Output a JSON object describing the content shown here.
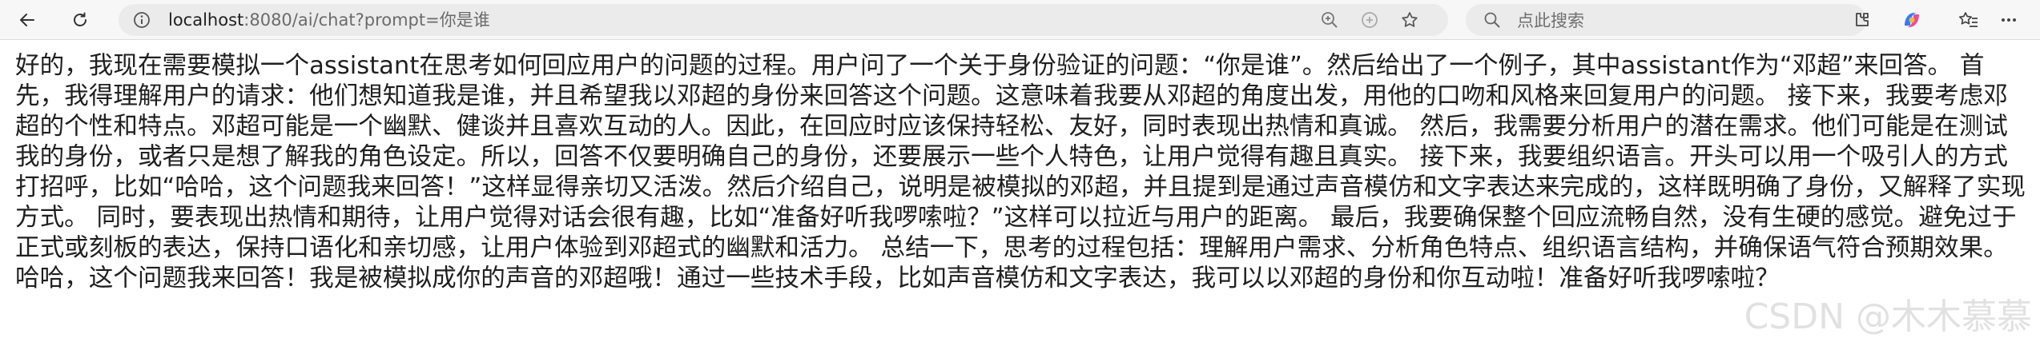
{
  "browser": {
    "url_host": "localhost",
    "url_rest": ":8080/ai/chat?prompt=你是谁",
    "search_placeholder": "点此搜索"
  },
  "main": {
    "response_text": "好的，我现在需要模拟一个assistant在思考如何回应用户的问题的过程。用户问了一个关于身份验证的问题：“你是谁”。然后给出了一个例子，其中assistant作为“邓超”来回答。 首先，我得理解用户的请求：他们想知道我是谁，并且希望我以邓超的身份来回答这个问题。这意味着我要从邓超的角度出发，用他的口吻和风格来回复用户的问题。 接下来，我要考虑邓超的个性和特点。邓超可能是一个幽默、健谈并且喜欢互动的人。因此，在回应时应该保持轻松、友好，同时表现出热情和真诚。 然后，我需要分析用户的潜在需求。他们可能是在测试我的身份，或者只是想了解我的角色设定。所以，回答不仅要明确自己的身份，还要展示一些个人特色，让用户觉得有趣且真实。 接下来，我要组织语言。开头可以用一个吸引人的方式打招呼，比如“哈哈，这个问题我来回答！”这样显得亲切又活泼。然后介绍自己，说明是被模拟的邓超，并且提到是通过声音模仿和文字表达来完成的，这样既明确了身份，又解释了实现方式。 同时，要表现出热情和期待，让用户觉得对话会很有趣，比如“准备好听我啰嗦啦？”这样可以拉近与用户的距离。 最后，我要确保整个回应流畅自然，没有生硬的感觉。避免过于正式或刻板的表达，保持口语化和亲切感，让用户体验到邓超式的幽默和活力。 总结一下，思考的过程包括：理解用户需求、分析角色特点、组织语言结构，并确保语气符合预期效果。 哈哈，这个问题我来回答！我是被模拟成你的声音的邓超哦！通过一些技术手段，比如声音模仿和文字表达，我可以以邓超的身份和你互动啦！准备好听我啰嗦啦？"
  },
  "watermark": "CSDN @木木慕慕"
}
